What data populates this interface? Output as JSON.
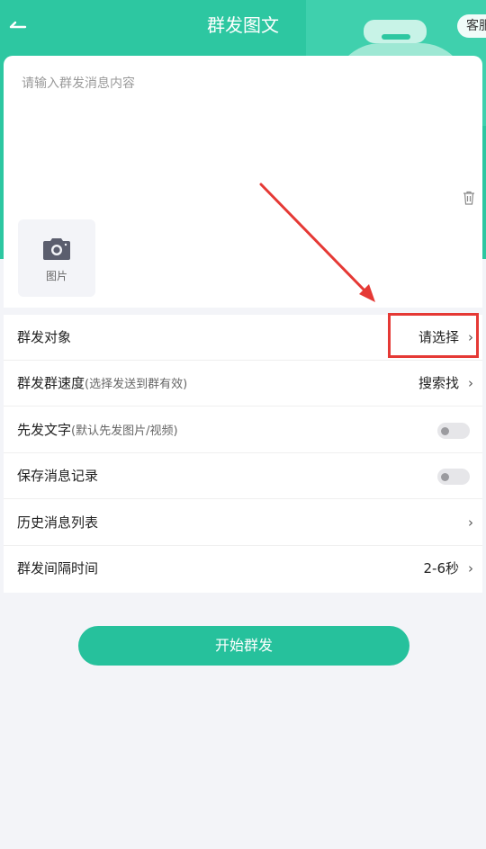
{
  "header": {
    "back_icon": "arrow-left-icon",
    "title": "群发图文",
    "service_label": "客服",
    "background_color": "#2dc7a1"
  },
  "editor": {
    "placeholder": "请输入群发消息内容",
    "trash_icon": "trash-icon",
    "image_picker_icon": "camera-icon",
    "image_picker_label": "图片"
  },
  "settings": {
    "rows": [
      {
        "label": "群发对象",
        "note": "",
        "value": "请选择",
        "control": "chevron"
      },
      {
        "label": "群发群速度",
        "note": "(选择发送到群有效)",
        "value": "搜索找",
        "control": "chevron"
      },
      {
        "label": "先发文字",
        "note": "(默认先发图片/视频)",
        "value": "",
        "control": "toggle",
        "on": false
      },
      {
        "label": "保存消息记录",
        "note": "",
        "value": "",
        "control": "toggle",
        "on": false
      },
      {
        "label": "历史消息列表",
        "note": "",
        "value": "",
        "control": "chevron"
      },
      {
        "label": "群发间隔时间",
        "note": "",
        "value": "2-6秒",
        "control": "chevron"
      }
    ]
  },
  "annotation": {
    "color": "#e53935"
  },
  "start_button": {
    "label": "开始群发",
    "color": "#26c19c"
  }
}
